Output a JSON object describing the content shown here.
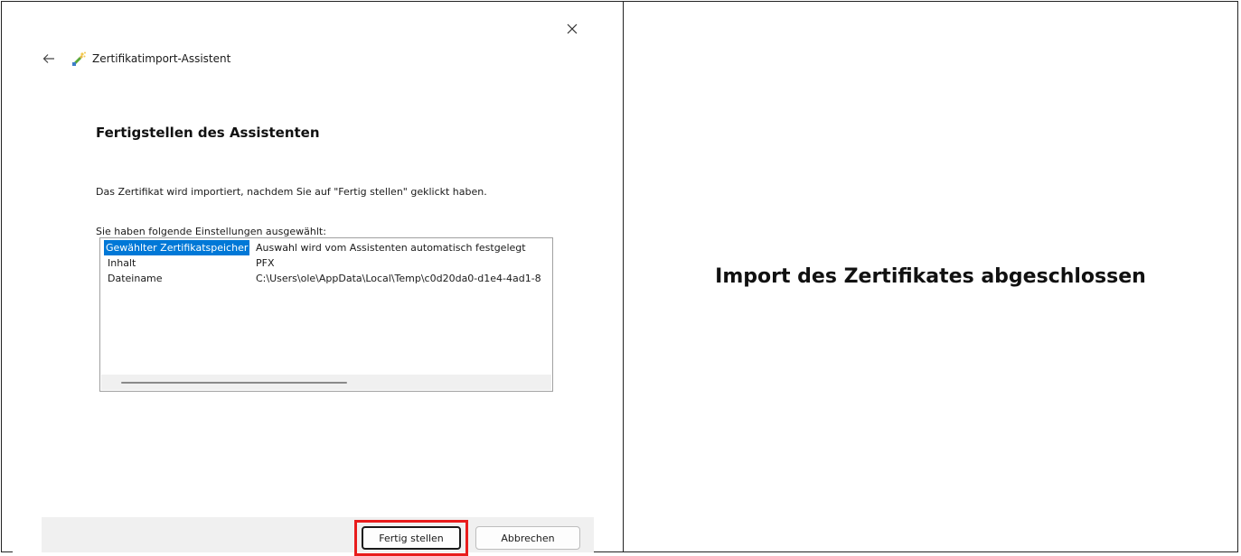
{
  "dialog": {
    "title": "Zertifikatimport-Assistent",
    "close_icon": "close-icon",
    "back_icon": "arrow-left-icon",
    "app_icon": "certificate-wizard-icon",
    "heading": "Fertigstellen des Assistenten",
    "description": "Das Zertifikat wird importiert, nachdem Sie auf \"Fertig stellen\" geklickt haben.",
    "settings_label": "Sie haben folgende Einstellungen ausgewählt:",
    "settings": [
      {
        "key": "Gewählter Zertifikatspeicher",
        "value": "Auswahl wird vom Assistenten automatisch festgelegt",
        "selected": true
      },
      {
        "key": "Inhalt",
        "value": "PFX",
        "selected": false
      },
      {
        "key": "Dateiname",
        "value": "C:\\Users\\ole\\AppData\\Local\\Temp\\c0d20da0-d1e4-4ad1-8",
        "selected": false
      }
    ],
    "buttons": {
      "finish": "Fertig stellen",
      "cancel": "Abbrechen"
    },
    "highlight_color": "#e81c1c",
    "selection_color": "#0078d7"
  },
  "caption": "Import des Zertifikates abgeschlossen"
}
